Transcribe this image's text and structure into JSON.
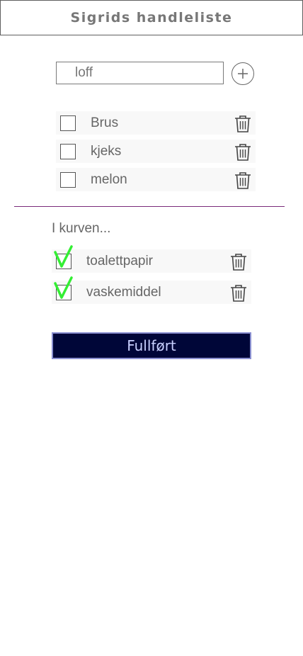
{
  "header": {
    "title": "Sigrids handleliste"
  },
  "add_item": {
    "input_value": "loff",
    "add_icon": "plus-circle-icon"
  },
  "todo": [
    {
      "label": "Brus",
      "checked": false
    },
    {
      "label": "kjeks",
      "checked": false
    },
    {
      "label": "melon",
      "checked": false
    }
  ],
  "cart": {
    "title": "I kurven...",
    "items": [
      {
        "label": "toalettpapir",
        "checked": true
      },
      {
        "label": "vaskemiddel",
        "checked": true
      }
    ]
  },
  "finish_button": {
    "label": "Fullført"
  },
  "colors": {
    "check_mark": "#33ee33",
    "divider": "#7a2a7a",
    "finish_bg": "#000638",
    "finish_text": "#c9d0ff"
  },
  "icons": {
    "delete": "trash-icon",
    "checked": "check-mark-icon"
  }
}
